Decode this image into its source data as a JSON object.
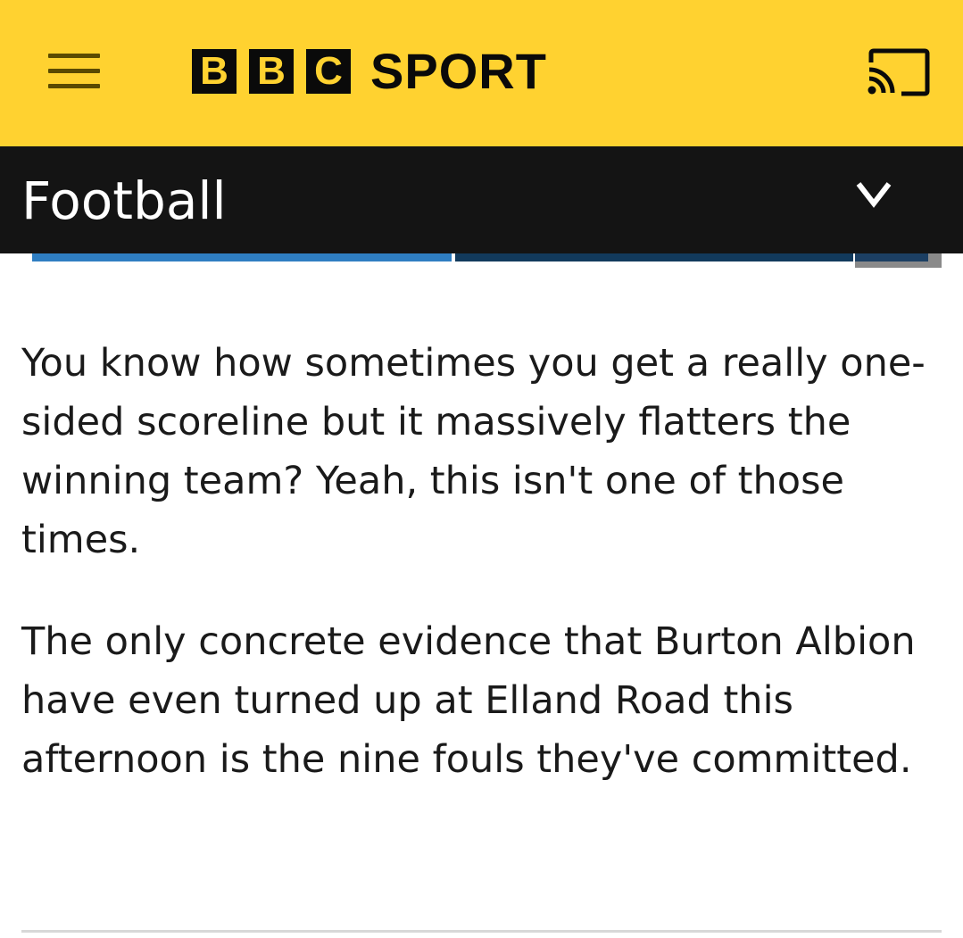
{
  "header": {
    "logo_letters": [
      "B",
      "B",
      "C"
    ],
    "logo_sport": "SPORT",
    "menu_icon": "hamburger-menu-icon",
    "cast_icon": "cast-icon",
    "brand_color": "#ffd230"
  },
  "section": {
    "title": "Football",
    "chevron_icon": "chevron-down-icon"
  },
  "article": {
    "paragraphs": [
      "You know how sometimes you get a really one-sided scoreline but it massively flatters the winning team? Yeah, this isn't one of those times.",
      "The only concrete evidence that Burton Albion have even turned up at Elland Road this afternoon is the nine fouls they've committed."
    ]
  }
}
